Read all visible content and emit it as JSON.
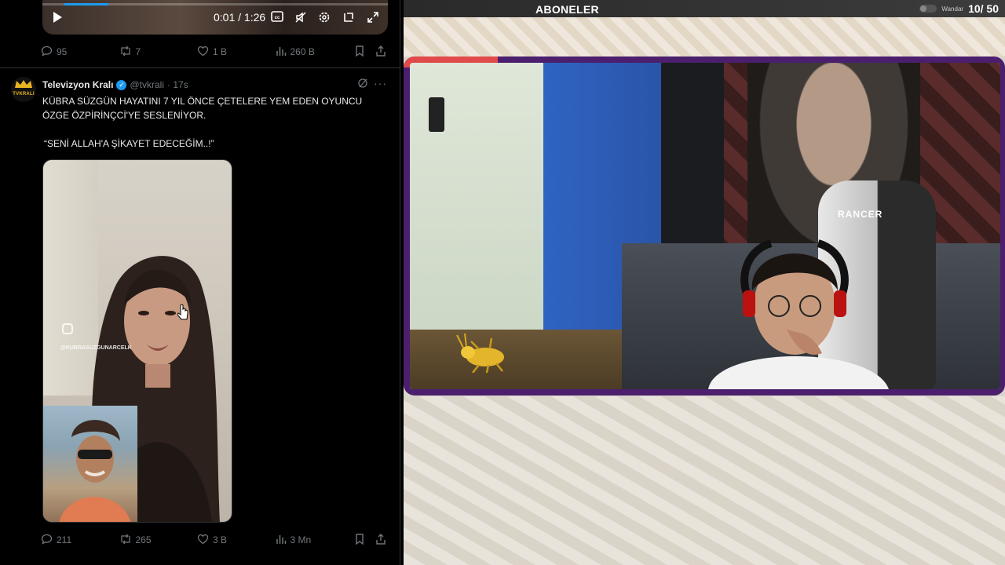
{
  "video": {
    "time": "0:01 / 1:26",
    "controls": [
      "play-icon",
      "cc-icon",
      "mute-icon",
      "settings-icon",
      "pip-icon",
      "fullscreen-icon"
    ]
  },
  "top_tweet_actions": {
    "replies": "95",
    "reposts": "7",
    "likes": "1 B",
    "views": "260 B"
  },
  "tweet": {
    "avatar_text": "TVKRALI",
    "name": "Televizyon Kralı",
    "handle": "@tvkrali",
    "time": "· 17s",
    "line1": "KÜBRA SÜZGÜN HAYATINI 7 YIL ÖNCE ÇETELERE YEM EDEN OYUNCU",
    "line2": "ÖZGE ÖZPİRİNÇCİ'YE SESLENİYOR.",
    "quote": "“SENİ ALLAH'A ŞİKAYET EDECEĞİM..!”",
    "ig_handle": "@KUBRASUZGUNARCELK",
    "actions": {
      "replies": "211",
      "reposts": "265",
      "likes": "3 B",
      "views": "3 Mn"
    }
  },
  "stream": {
    "subs_label": "ABONELER",
    "subs_user": "Wandar",
    "subs_count": "10/ 50",
    "chair_brand": "RANCER"
  },
  "colors": {
    "accent_blue": "#1d9bf0",
    "frame_purple": "#4b1f6d",
    "frame_red": "#e04a4a"
  }
}
